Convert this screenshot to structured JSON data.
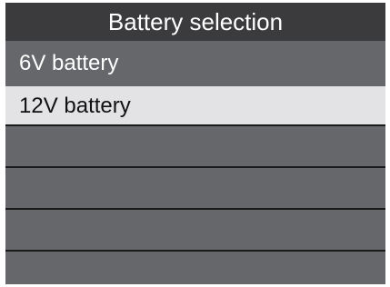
{
  "header": {
    "title": "Battery selection"
  },
  "menu": {
    "items": [
      {
        "label": "6V battery",
        "selected": false
      },
      {
        "label": "12V battery",
        "selected": true
      },
      {
        "label": "",
        "selected": false
      },
      {
        "label": "",
        "selected": false
      },
      {
        "label": "",
        "selected": false
      },
      {
        "label": "",
        "selected": false
      }
    ]
  },
  "colors": {
    "background": "#66676a",
    "header": "#3b3b3d",
    "selected_row": "#e3e3e5",
    "divider": "#1a1a1a",
    "text": "#ffffff",
    "selected_text": "#111111"
  }
}
